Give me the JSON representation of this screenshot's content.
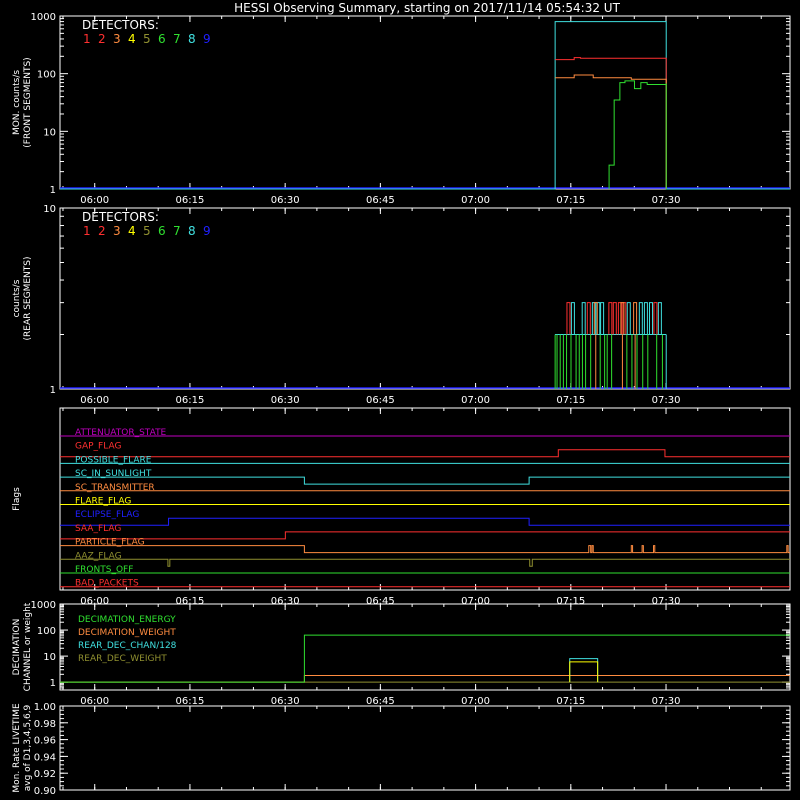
{
  "title": "HESSI Observing Summary, starting on 2017/11/14 05:54:32 UT",
  "colors": {
    "d1": "#ff3030",
    "d2": "#ff3030",
    "d3": "#ff8c40",
    "d4": "#ffff00",
    "d5": "#909030",
    "d6": "#30e030",
    "d7": "#30e030",
    "d8": "#40e0e0",
    "d9": "#2020ff",
    "magenta": "#c000c0",
    "red": "#ff3030",
    "cyan": "#40e0e0",
    "orange": "#ff8c40",
    "yellow": "#ffff00",
    "blue": "#2020ff",
    "olive": "#909030",
    "green": "#30e030"
  },
  "time_axis": {
    "range_min": [
      0,
      115
    ],
    "ticks": [
      {
        "label": "06:00",
        "min": 5.47
      },
      {
        "label": "06:15",
        "min": 20.47
      },
      {
        "label": "06:30",
        "min": 35.47
      },
      {
        "label": "06:45",
        "min": 50.47
      },
      {
        "label": "07:00",
        "min": 65.47
      },
      {
        "label": "07:15",
        "min": 80.47
      },
      {
        "label": "07:30",
        "min": 95.47
      }
    ]
  },
  "chart_data": [
    {
      "type": "line",
      "panel": "front",
      "ylabel": [
        "MON. counts/s",
        "(FRONT SEGMENTS)"
      ],
      "yscale": "log",
      "ylim": [
        1,
        1000
      ],
      "yticks": [
        "1",
        "10",
        "100",
        "1000"
      ],
      "legend_title": "DETECTORS:",
      "legend_items": [
        "1",
        "2",
        "3",
        "4",
        "5",
        "6",
        "7",
        "8",
        "9"
      ],
      "series": [
        {
          "color": "cyan",
          "x": [
            0,
            78,
            78,
            95.5,
            95.5,
            115
          ],
          "y": [
            1,
            1,
            800,
            820,
            1,
            1
          ]
        },
        {
          "color": "red",
          "x": [
            78,
            81,
            82,
            95.5,
            95.5
          ],
          "y": [
            175,
            190,
            185,
            185,
            1
          ]
        },
        {
          "color": "orange",
          "x": [
            78,
            81,
            84,
            90,
            95.5,
            95.5
          ],
          "y": [
            85,
            95,
            85,
            80,
            75,
            1
          ]
        },
        {
          "color": "green",
          "x": [
            86.5,
            86.5,
            87.3,
            87.3,
            88.2,
            88.2,
            89,
            90.5,
            91.5,
            92.5,
            95.5,
            95.5
          ],
          "y": [
            1,
            2.6,
            2.6,
            35,
            35,
            70,
            75,
            55,
            70,
            65,
            68,
            1
          ]
        }
      ]
    },
    {
      "type": "line",
      "panel": "rear",
      "ylabel": [
        "counts/s",
        "(REAR SEGMENTS)"
      ],
      "yscale": "log",
      "ylim": [
        1,
        10
      ],
      "yticks": [
        "1",
        "10"
      ],
      "legend_title": "DETECTORS:",
      "legend_items": [
        "1",
        "2",
        "3",
        "4",
        "5",
        "6",
        "7",
        "8",
        "9"
      ],
      "plateau": 2,
      "spike_level": 3,
      "active_range_min": [
        78,
        95.5
      ],
      "spikes": [
        {
          "color": "cyan",
          "x": [
            80.8,
            82.5,
            84.1,
            84.8,
            85.4,
            89.6,
            91.5,
            92.3,
            93.1,
            94.5
          ]
        },
        {
          "color": "red",
          "x": [
            80.1,
            83.3,
            86.7,
            87.4,
            88.2,
            88.9,
            93.8
          ]
        },
        {
          "color": "orange",
          "x": [
            84.4,
            88.6,
            90.6
          ]
        },
        {
          "color": "green",
          "x": [
            78.3,
            78.8,
            79.3,
            79.8,
            80.5,
            81.3,
            81.8,
            82.3,
            82.8,
            83.6,
            85.1,
            85.8,
            86.2,
            86.9,
            89.3,
            90.1,
            90.9,
            91.8,
            92.6,
            94.0,
            94.9
          ]
        }
      ]
    },
    {
      "type": "step",
      "panel": "flags",
      "ylabel": "Flags",
      "flags": [
        {
          "label": "ATTENUATOR_STATE",
          "color": "magenta",
          "steps": [
            [
              0,
              0
            ]
          ]
        },
        {
          "label": "GAP_FLAG",
          "color": "red",
          "steps": [
            [
              0,
              1
            ],
            [
              78.5,
              0
            ],
            [
              95.3,
              1
            ]
          ]
        },
        {
          "label": "POSSIBLE_FLARE",
          "color": "cyan",
          "steps": [
            [
              0,
              0
            ]
          ]
        },
        {
          "label": "SC_IN_SUNLIGHT",
          "color": "cyan",
          "steps": [
            [
              0,
              0
            ],
            [
              38.5,
              1
            ],
            [
              73.9,
              0
            ]
          ]
        },
        {
          "label": "SC_TRANSMITTER",
          "color": "orange",
          "steps": [
            [
              0,
              0
            ]
          ]
        },
        {
          "label": "FLARE_FLAG",
          "color": "yellow",
          "steps": [
            [
              0,
              0
            ]
          ]
        },
        {
          "label": "ECLIPSE_FLAG",
          "color": "blue",
          "steps": [
            [
              0,
              1
            ],
            [
              17.1,
              0
            ],
            [
              73.9,
              1
            ]
          ]
        },
        {
          "label": "SAA_FLAG",
          "color": "red",
          "steps": [
            [
              0,
              1
            ],
            [
              35.5,
              0
            ]
          ]
        },
        {
          "label": "PARTICLE_FLAG",
          "color": "orange",
          "steps": [
            [
              0,
              0
            ],
            [
              38.5,
              1
            ],
            [
              83.3,
              0
            ],
            [
              83.6,
              1
            ],
            [
              83.8,
              0
            ],
            [
              84.0,
              1
            ],
            [
              90.0,
              0
            ],
            [
              90.2,
              1
            ],
            [
              91.7,
              0
            ],
            [
              91.9,
              1
            ],
            [
              93.5,
              0
            ],
            [
              93.7,
              1
            ],
            [
              114.5,
              0
            ],
            [
              114.7,
              1
            ]
          ]
        },
        {
          "label": "AAZ_FLAG",
          "color": "olive",
          "steps": [
            [
              0,
              0
            ],
            [
              17.0,
              1
            ],
            [
              17.3,
              0
            ],
            [
              74.0,
              1
            ],
            [
              74.4,
              0
            ]
          ]
        },
        {
          "label": "FRONTS_OFF",
          "color": "green",
          "steps": [
            [
              0,
              0
            ]
          ]
        },
        {
          "label": "BAD_PACKETS",
          "color": "red",
          "steps": [
            [
              0,
              0
            ]
          ]
        }
      ]
    },
    {
      "type": "line",
      "panel": "decimation",
      "ylabel": [
        "DECIMATION",
        "CHANNEL or weight"
      ],
      "yscale": "log",
      "ylim": [
        0.5,
        1000
      ],
      "yticks": [
        "1",
        "10",
        "100",
        "1000"
      ],
      "legend_items": [
        {
          "label": "DECIMATION_ENERGY",
          "color": "green"
        },
        {
          "label": "DECIMATION_WEIGHT",
          "color": "orange"
        },
        {
          "label": "REAR_DEC_CHAN/128",
          "color": "cyan"
        },
        {
          "label": "REAR_DEC_WEIGHT",
          "color": "olive"
        }
      ],
      "series": [
        {
          "color": "olive",
          "x": [
            0,
            115
          ],
          "y": [
            1,
            1
          ]
        },
        {
          "color": "orange",
          "x": [
            0,
            38.5,
            38.5,
            115
          ],
          "y": [
            1,
            1,
            1.8,
            1.8
          ]
        },
        {
          "color": "green",
          "x": [
            0,
            38.5,
            38.5,
            115
          ],
          "y": [
            1,
            1,
            64,
            64
          ]
        },
        {
          "color": "cyan",
          "x": [
            80.3,
            80.3,
            84.7,
            84.7
          ],
          "y": [
            1,
            8,
            8,
            1
          ]
        },
        {
          "color": "yellow",
          "x": [
            80.3,
            80.3,
            84.7,
            84.7
          ],
          "y": [
            1,
            6,
            6,
            1
          ]
        }
      ]
    },
    {
      "type": "line",
      "panel": "livetime",
      "ylabel": [
        "Mon. Rate LIVETIME",
        "avg of D1,3,4,5,6,9"
      ],
      "ylim": [
        0.9,
        1.0
      ],
      "yticks": [
        "0.90",
        "0.92",
        "0.94",
        "0.96",
        "0.98",
        "1.00"
      ],
      "series": []
    }
  ]
}
